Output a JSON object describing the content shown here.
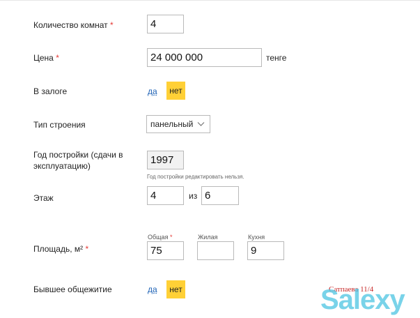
{
  "form": {
    "rooms": {
      "label": "Количество комнат",
      "required": "*",
      "value": "4"
    },
    "price": {
      "label": "Цена",
      "required": "*",
      "value": "24 000 000",
      "unit": "тенге"
    },
    "pledge": {
      "label": "В залоге",
      "yes": "да",
      "no": "нет",
      "selected": "нет"
    },
    "building_type": {
      "label": "Тип строения",
      "value": "панельный"
    },
    "year_built": {
      "label_line1": "Год постройки (сдачи в",
      "label_line2": "эксплуатацию)",
      "value": "1997",
      "note": "Год постройки редактировать нельзя."
    },
    "floor": {
      "label": "Этаж",
      "value": "4",
      "of": "из",
      "total": "6"
    },
    "area": {
      "label": "Площадь, м²",
      "required": "*",
      "total_label": "Общая",
      "total_required": "*",
      "total_value": "75",
      "living_label": "Жилая",
      "living_value": "",
      "kitchen_label": "Кухня",
      "kitchen_value": "9"
    },
    "dormitory": {
      "label": "Бывшее общежитие",
      "yes": "да",
      "no": "нет",
      "selected": "нет"
    }
  },
  "map_label": "Сатпаева 11/4",
  "watermark": "Salexy",
  "colors": {
    "accent_yellow": "#ffd036",
    "link_blue": "#1f63b6",
    "required_red": "#e53935"
  }
}
